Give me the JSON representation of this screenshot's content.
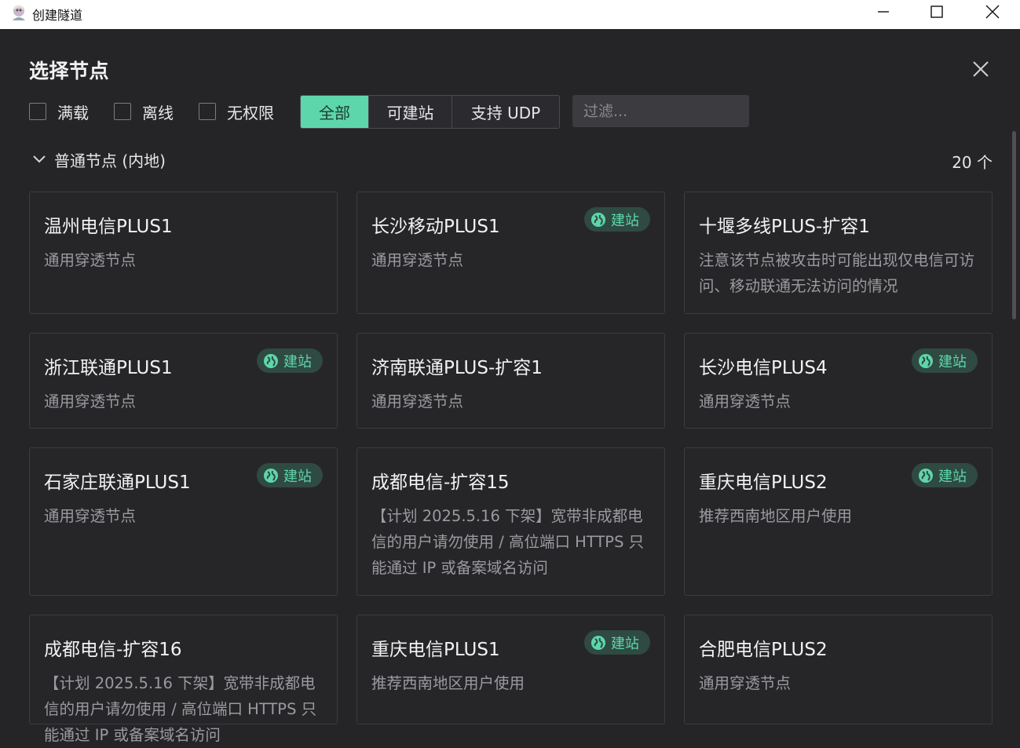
{
  "window": {
    "title": "创建隧道",
    "icon_name": "app-avatar-icon"
  },
  "dialog": {
    "title": "选择节点",
    "filters": {
      "checkboxes": [
        "满载",
        "离线",
        "无权限"
      ],
      "segments": [
        "全部",
        "可建站",
        "支持 UDP"
      ],
      "active_segment": "全部",
      "search_placeholder": "过滤..."
    },
    "section": {
      "title": "普通节点 (内地)",
      "count": "20 个"
    },
    "badge_label": "建站",
    "nodes": [
      {
        "name": "温州电信PLUS1",
        "desc": "通用穿透节点",
        "site": false
      },
      {
        "name": "长沙移动PLUS1",
        "desc": "通用穿透节点",
        "site": true
      },
      {
        "name": "十堰多线PLUS-扩容1",
        "desc": "注意该节点被攻击时可能出现仅电信可访问、移动联通无法访问的情况",
        "site": false
      },
      {
        "name": "浙江联通PLUS1",
        "desc": "通用穿透节点",
        "site": true
      },
      {
        "name": "济南联通PLUS-扩容1",
        "desc": "通用穿透节点",
        "site": false
      },
      {
        "name": "长沙电信PLUS4",
        "desc": "通用穿透节点",
        "site": true
      },
      {
        "name": "石家庄联通PLUS1",
        "desc": "通用穿透节点",
        "site": true
      },
      {
        "name": "成都电信-扩容15",
        "desc": "【计划 2025.5.16 下架】宽带非成都电信的用户请勿使用 / 高位端口 HTTPS 只能通过 IP 或备案域名访问",
        "site": false
      },
      {
        "name": "重庆电信PLUS2",
        "desc": "推荐西南地区用户使用",
        "site": true
      },
      {
        "name": "成都电信-扩容16",
        "desc": "【计划 2025.5.16 下架】宽带非成都电信的用户请勿使用 / 高位端口 HTTPS 只能通过 IP 或备案域名访问",
        "site": false
      },
      {
        "name": "重庆电信PLUS1",
        "desc": "推荐西南地区用户使用",
        "site": true
      },
      {
        "name": "合肥电信PLUS2",
        "desc": "通用穿透节点",
        "site": false
      }
    ]
  },
  "colors": {
    "accent": "#5ed6ab",
    "badge_bg": "#2f4a42",
    "background": "#252528"
  }
}
